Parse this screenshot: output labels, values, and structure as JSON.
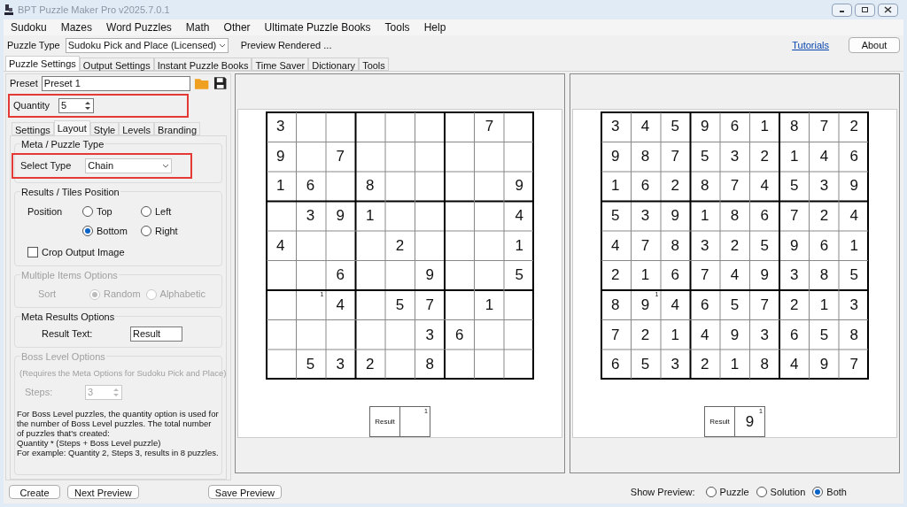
{
  "window": {
    "title": "BPT Puzzle Maker Pro v2025.7.0.1"
  },
  "menu": [
    "Sudoku",
    "Mazes",
    "Word Puzzles",
    "Math",
    "Other",
    "Ultimate Puzzle Books",
    "Tools",
    "Help"
  ],
  "toolbar": {
    "label": "Puzzle Type",
    "value": "Sudoku Pick and Place (Licensed)",
    "status": "Preview Rendered ...",
    "link": "Tutorials",
    "button": "About"
  },
  "tabs": [
    {
      "label": "Puzzle Settings",
      "selected": true
    },
    {
      "label": "Output Settings",
      "selected": false
    },
    {
      "label": "Instant Puzzle Books",
      "selected": false
    },
    {
      "label": "Time Saver",
      "selected": false
    },
    {
      "label": "Dictionary",
      "selected": false
    },
    {
      "label": "Tools",
      "selected": false
    }
  ],
  "preset": {
    "label": "Preset",
    "value": "Preset 1"
  },
  "quantity": {
    "label": "Quantity",
    "value": "5",
    "highlighted": true
  },
  "subtabs": [
    {
      "label": "Settings",
      "selected": false
    },
    {
      "label": "Layout",
      "selected": true
    },
    {
      "label": "Style",
      "selected": false
    },
    {
      "label": "Levels",
      "selected": false
    },
    {
      "label": "Branding",
      "selected": false
    }
  ],
  "meta_type": {
    "title": "Meta / Puzzle Type",
    "label": "Select Type",
    "value": "Chain",
    "highlighted": true
  },
  "results_position": {
    "title": "Results / Tiles Position",
    "label": "Position",
    "options": [
      {
        "label": "Top",
        "selected": false
      },
      {
        "label": "Left",
        "selected": false
      },
      {
        "label": "Bottom",
        "selected": true
      },
      {
        "label": "Right",
        "selected": false
      }
    ],
    "crop": {
      "label": "Crop Output Image",
      "checked": false
    }
  },
  "multiple_items": {
    "title": "Multiple Items Options",
    "disabled": true,
    "label": "Sort",
    "options": [
      {
        "label": "Random",
        "selected": true
      },
      {
        "label": "Alphabetic",
        "selected": false
      }
    ]
  },
  "meta_results": {
    "title": "Meta Results Options",
    "label": "Result Text:",
    "value": "Result"
  },
  "boss_level": {
    "title": "Boss Level Options",
    "disabled": true,
    "note": "(Requires the Meta Options for Sudoku Pick and Place)",
    "steps_label": "Steps:",
    "steps_value": "3",
    "help": [
      "For Boss Level puzzles, the quantity option is used for the number of Boss Level puzzles. The total number of puzzles that's created:",
      "Quantity * (Steps + Boss Level puzzle)",
      "For example: Quantity 2, Steps 3, results in 8 puzzles."
    ]
  },
  "previews": [
    {
      "grid": [
        [
          {
            "value": "3"
          },
          {
            "kind": "blank"
          },
          {
            "kind": "blank"
          },
          {
            "kind": "blank"
          },
          {
            "kind": "blank"
          },
          {
            "kind": "blank"
          },
          {
            "kind": "blank"
          },
          {
            "value": "7"
          },
          {
            "kind": "blank"
          }
        ],
        [
          {
            "value": "9"
          },
          {
            "kind": "blank"
          },
          {
            "value": "7"
          },
          {
            "kind": "blank"
          },
          {
            "kind": "blank"
          },
          {
            "kind": "blank"
          },
          {
            "kind": "blank"
          },
          {
            "kind": "blank"
          },
          {
            "kind": "blank"
          }
        ],
        [
          {
            "value": "1"
          },
          {
            "value": "6"
          },
          {
            "kind": "blank"
          },
          {
            "value": "8"
          },
          {
            "kind": "blank"
          },
          {
            "kind": "blank"
          },
          {
            "kind": "blank"
          },
          {
            "kind": "blank"
          },
          {
            "value": "9"
          }
        ],
        [
          {
            "kind": "blank"
          },
          {
            "value": "3"
          },
          {
            "value": "9"
          },
          {
            "value": "1"
          },
          {
            "kind": "blank"
          },
          {
            "kind": "blank"
          },
          {
            "kind": "blank"
          },
          {
            "kind": "blank"
          },
          {
            "value": "4"
          }
        ],
        [
          {
            "value": "4"
          },
          {
            "kind": "blank"
          },
          {
            "kind": "blank"
          },
          {
            "kind": "blank"
          },
          {
            "value": "2"
          },
          {
            "kind": "blank"
          },
          {
            "kind": "blank"
          },
          {
            "kind": "blank"
          },
          {
            "value": "1"
          }
        ],
        [
          {
            "kind": "blank"
          },
          {
            "kind": "blank"
          },
          {
            "value": "6"
          },
          {
            "kind": "blank"
          },
          {
            "kind": "blank"
          },
          {
            "value": "9"
          },
          {
            "kind": "blank"
          },
          {
            "kind": "blank"
          },
          {
            "value": "5"
          }
        ],
        [
          {
            "kind": "blank"
          },
          {
            "kind": "blank",
            "corner": "1"
          },
          {
            "value": "4"
          },
          {
            "kind": "blank"
          },
          {
            "value": "5"
          },
          {
            "value": "7"
          },
          {
            "kind": "blank"
          },
          {
            "value": "1"
          },
          {
            "kind": "blank"
          }
        ],
        [
          {
            "kind": "blank"
          },
          {
            "kind": "blank"
          },
          {
            "kind": "blank"
          },
          {
            "kind": "blank"
          },
          {
            "kind": "blank"
          },
          {
            "value": "3"
          },
          {
            "value": "6"
          },
          {
            "kind": "blank"
          },
          {
            "kind": "blank"
          }
        ],
        [
          {
            "kind": "blank"
          },
          {
            "value": "5"
          },
          {
            "value": "3"
          },
          {
            "value": "2"
          },
          {
            "kind": "blank"
          },
          {
            "value": "8"
          },
          {
            "kind": "blank"
          },
          {
            "kind": "blank"
          },
          {
            "kind": "blank"
          }
        ]
      ],
      "result": {
        "label": "Result",
        "corner": "1"
      }
    },
    {
      "grid": [
        [
          {
            "value": "3"
          },
          {
            "value": "4"
          },
          {
            "value": "5"
          },
          {
            "value": "9"
          },
          {
            "value": "6"
          },
          {
            "value": "1"
          },
          {
            "value": "8"
          },
          {
            "value": "7"
          },
          {
            "value": "2"
          }
        ],
        [
          {
            "value": "9"
          },
          {
            "value": "8"
          },
          {
            "value": "7"
          },
          {
            "value": "5"
          },
          {
            "value": "3"
          },
          {
            "value": "2"
          },
          {
            "value": "1"
          },
          {
            "value": "4"
          },
          {
            "value": "6"
          }
        ],
        [
          {
            "value": "1"
          },
          {
            "value": "6"
          },
          {
            "value": "2"
          },
          {
            "value": "8"
          },
          {
            "value": "7"
          },
          {
            "value": "4"
          },
          {
            "value": "5"
          },
          {
            "value": "3"
          },
          {
            "value": "9"
          }
        ],
        [
          {
            "value": "5"
          },
          {
            "value": "3"
          },
          {
            "value": "9"
          },
          {
            "value": "1"
          },
          {
            "value": "8"
          },
          {
            "value": "6"
          },
          {
            "value": "7"
          },
          {
            "value": "2"
          },
          {
            "value": "4"
          }
        ],
        [
          {
            "value": "4"
          },
          {
            "value": "7"
          },
          {
            "value": "8"
          },
          {
            "value": "3"
          },
          {
            "value": "2"
          },
          {
            "value": "5"
          },
          {
            "value": "9"
          },
          {
            "value": "6"
          },
          {
            "value": "1"
          }
        ],
        [
          {
            "value": "2"
          },
          {
            "value": "1"
          },
          {
            "value": "6"
          },
          {
            "value": "7"
          },
          {
            "value": "4"
          },
          {
            "value": "9"
          },
          {
            "value": "3"
          },
          {
            "value": "8"
          },
          {
            "value": "5"
          }
        ],
        [
          {
            "value": "8"
          },
          {
            "value": "9",
            "corner": "1"
          },
          {
            "value": "4"
          },
          {
            "value": "6"
          },
          {
            "value": "5"
          },
          {
            "value": "7"
          },
          {
            "value": "2"
          },
          {
            "value": "1"
          },
          {
            "value": "3"
          }
        ],
        [
          {
            "value": "7"
          },
          {
            "value": "2"
          },
          {
            "value": "1"
          },
          {
            "value": "4"
          },
          {
            "value": "9"
          },
          {
            "value": "3"
          },
          {
            "value": "6"
          },
          {
            "value": "5"
          },
          {
            "value": "8"
          }
        ],
        [
          {
            "value": "6"
          },
          {
            "value": "5"
          },
          {
            "value": "3"
          },
          {
            "value": "2"
          },
          {
            "value": "1"
          },
          {
            "value": "8"
          },
          {
            "value": "4"
          },
          {
            "value": "9"
          },
          {
            "value": "7"
          }
        ]
      ],
      "result": {
        "label": "Result",
        "value": "9",
        "corner": "1"
      }
    }
  ],
  "bottom_buttons": [
    "Create",
    "Next Preview",
    "Save Preview"
  ],
  "show_preview": {
    "label": "Show Preview:",
    "options": [
      {
        "label": "Puzzle",
        "selected": false
      },
      {
        "label": "Solution",
        "selected": false
      },
      {
        "label": "Both",
        "selected": true
      }
    ]
  }
}
